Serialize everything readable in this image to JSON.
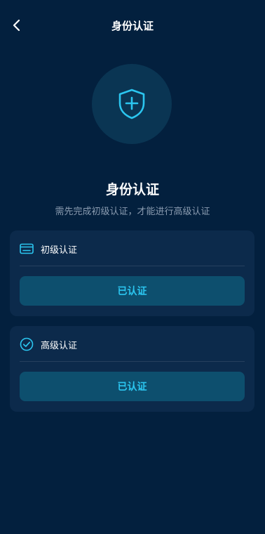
{
  "header": {
    "title": "身份认证",
    "back_icon": "chevron-left-icon"
  },
  "hero": {
    "icon": "shield-plus-icon",
    "title": "身份认证",
    "subtitle": "需先完成初级认证，才能进行高级认证"
  },
  "cards": [
    {
      "icon": "id-card-icon",
      "label": "初级认证",
      "status": "已认证"
    },
    {
      "icon": "check-circle-icon",
      "label": "高级认证",
      "status": "已认证"
    }
  ],
  "colors": {
    "background": "#03203e",
    "card": "#0c2a4b",
    "accent": "#2bc6f0",
    "button": "#0d4f6e"
  }
}
